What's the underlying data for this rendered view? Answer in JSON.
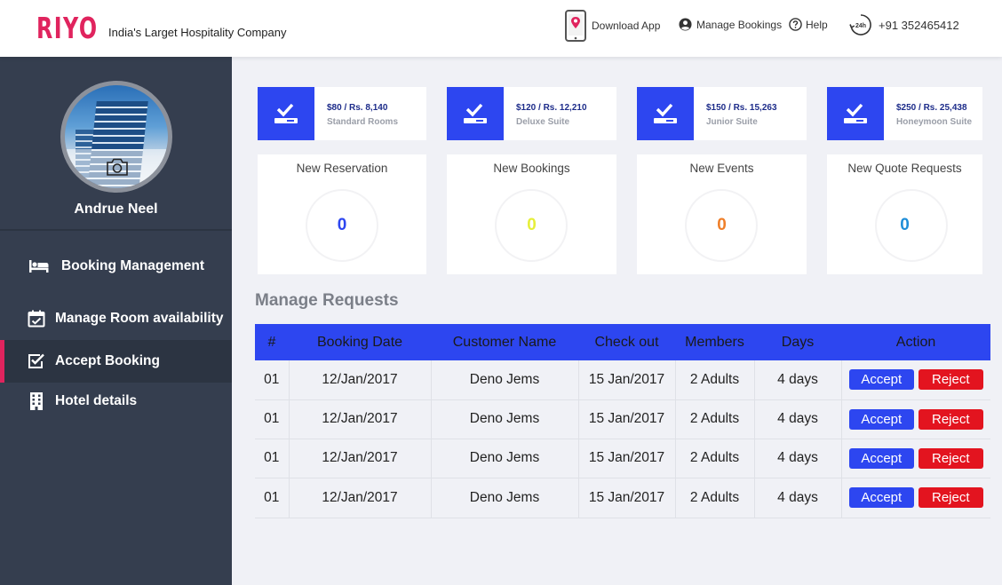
{
  "brand": {
    "logo_text": "RIYO",
    "tagline": "India's Larget Hospitality Company",
    "accent_color": "#e0245e",
    "primary_color": "#2d46f0",
    "danger_color": "#e3141f"
  },
  "header": {
    "download_app": "Download App",
    "manage_bookings": "Manage Bookings",
    "help": "Help",
    "phone_badge": "24h",
    "phone": "+91 352465412"
  },
  "sidebar": {
    "user_name": "Andrue Neel",
    "items": [
      {
        "label": "Booking Management",
        "icon": "bed-icon",
        "active": false
      },
      {
        "label": "Manage Room availability",
        "icon": "calendar-check-icon",
        "active": false
      },
      {
        "label": "Accept Booking",
        "icon": "checkbox-icon",
        "active": true
      },
      {
        "label": "Hotel details",
        "icon": "building-icon",
        "active": false
      }
    ]
  },
  "rooms": [
    {
      "price": "$80 / Rs. 8,140",
      "name": "Standard Rooms"
    },
    {
      "price": "$120 / Rs. 12,210",
      "name": "Deluxe Suite"
    },
    {
      "price": "$150 / Rs. 15,263",
      "name": "Junior Suite"
    },
    {
      "price": "$250 / Rs. 25,438",
      "name": "Honeymoon Suite"
    }
  ],
  "stats": [
    {
      "title": "New Reservation",
      "value": "0",
      "color": "#2d46f0"
    },
    {
      "title": "New Bookings",
      "value": "0",
      "color": "#e6ef3a"
    },
    {
      "title": "New Events",
      "value": "0",
      "color": "#ef7f2a"
    },
    {
      "title": "New Quote Requests",
      "value": "0",
      "color": "#1f8ed8"
    }
  ],
  "requests": {
    "title": "Manage Requests",
    "columns": [
      "#",
      "Booking Date",
      "Customer Name",
      "Check out",
      "Members",
      "Days",
      "Action"
    ],
    "accept_label": "Accept",
    "reject_label": "Reject",
    "rows": [
      {
        "num": "01",
        "booking_date": "12/Jan/2017",
        "customer": "Deno Jems",
        "checkout": "15 Jan/2017",
        "members": "2 Adults",
        "days": "4 days"
      },
      {
        "num": "01",
        "booking_date": "12/Jan/2017",
        "customer": "Deno Jems",
        "checkout": "15 Jan/2017",
        "members": "2 Adults",
        "days": "4 days"
      },
      {
        "num": "01",
        "booking_date": "12/Jan/2017",
        "customer": "Deno Jems",
        "checkout": "15 Jan/2017",
        "members": "2 Adults",
        "days": "4 days"
      },
      {
        "num": "01",
        "booking_date": "12/Jan/2017",
        "customer": "Deno Jems",
        "checkout": "15 Jan/2017",
        "members": "2 Adults",
        "days": "4 days"
      }
    ]
  }
}
